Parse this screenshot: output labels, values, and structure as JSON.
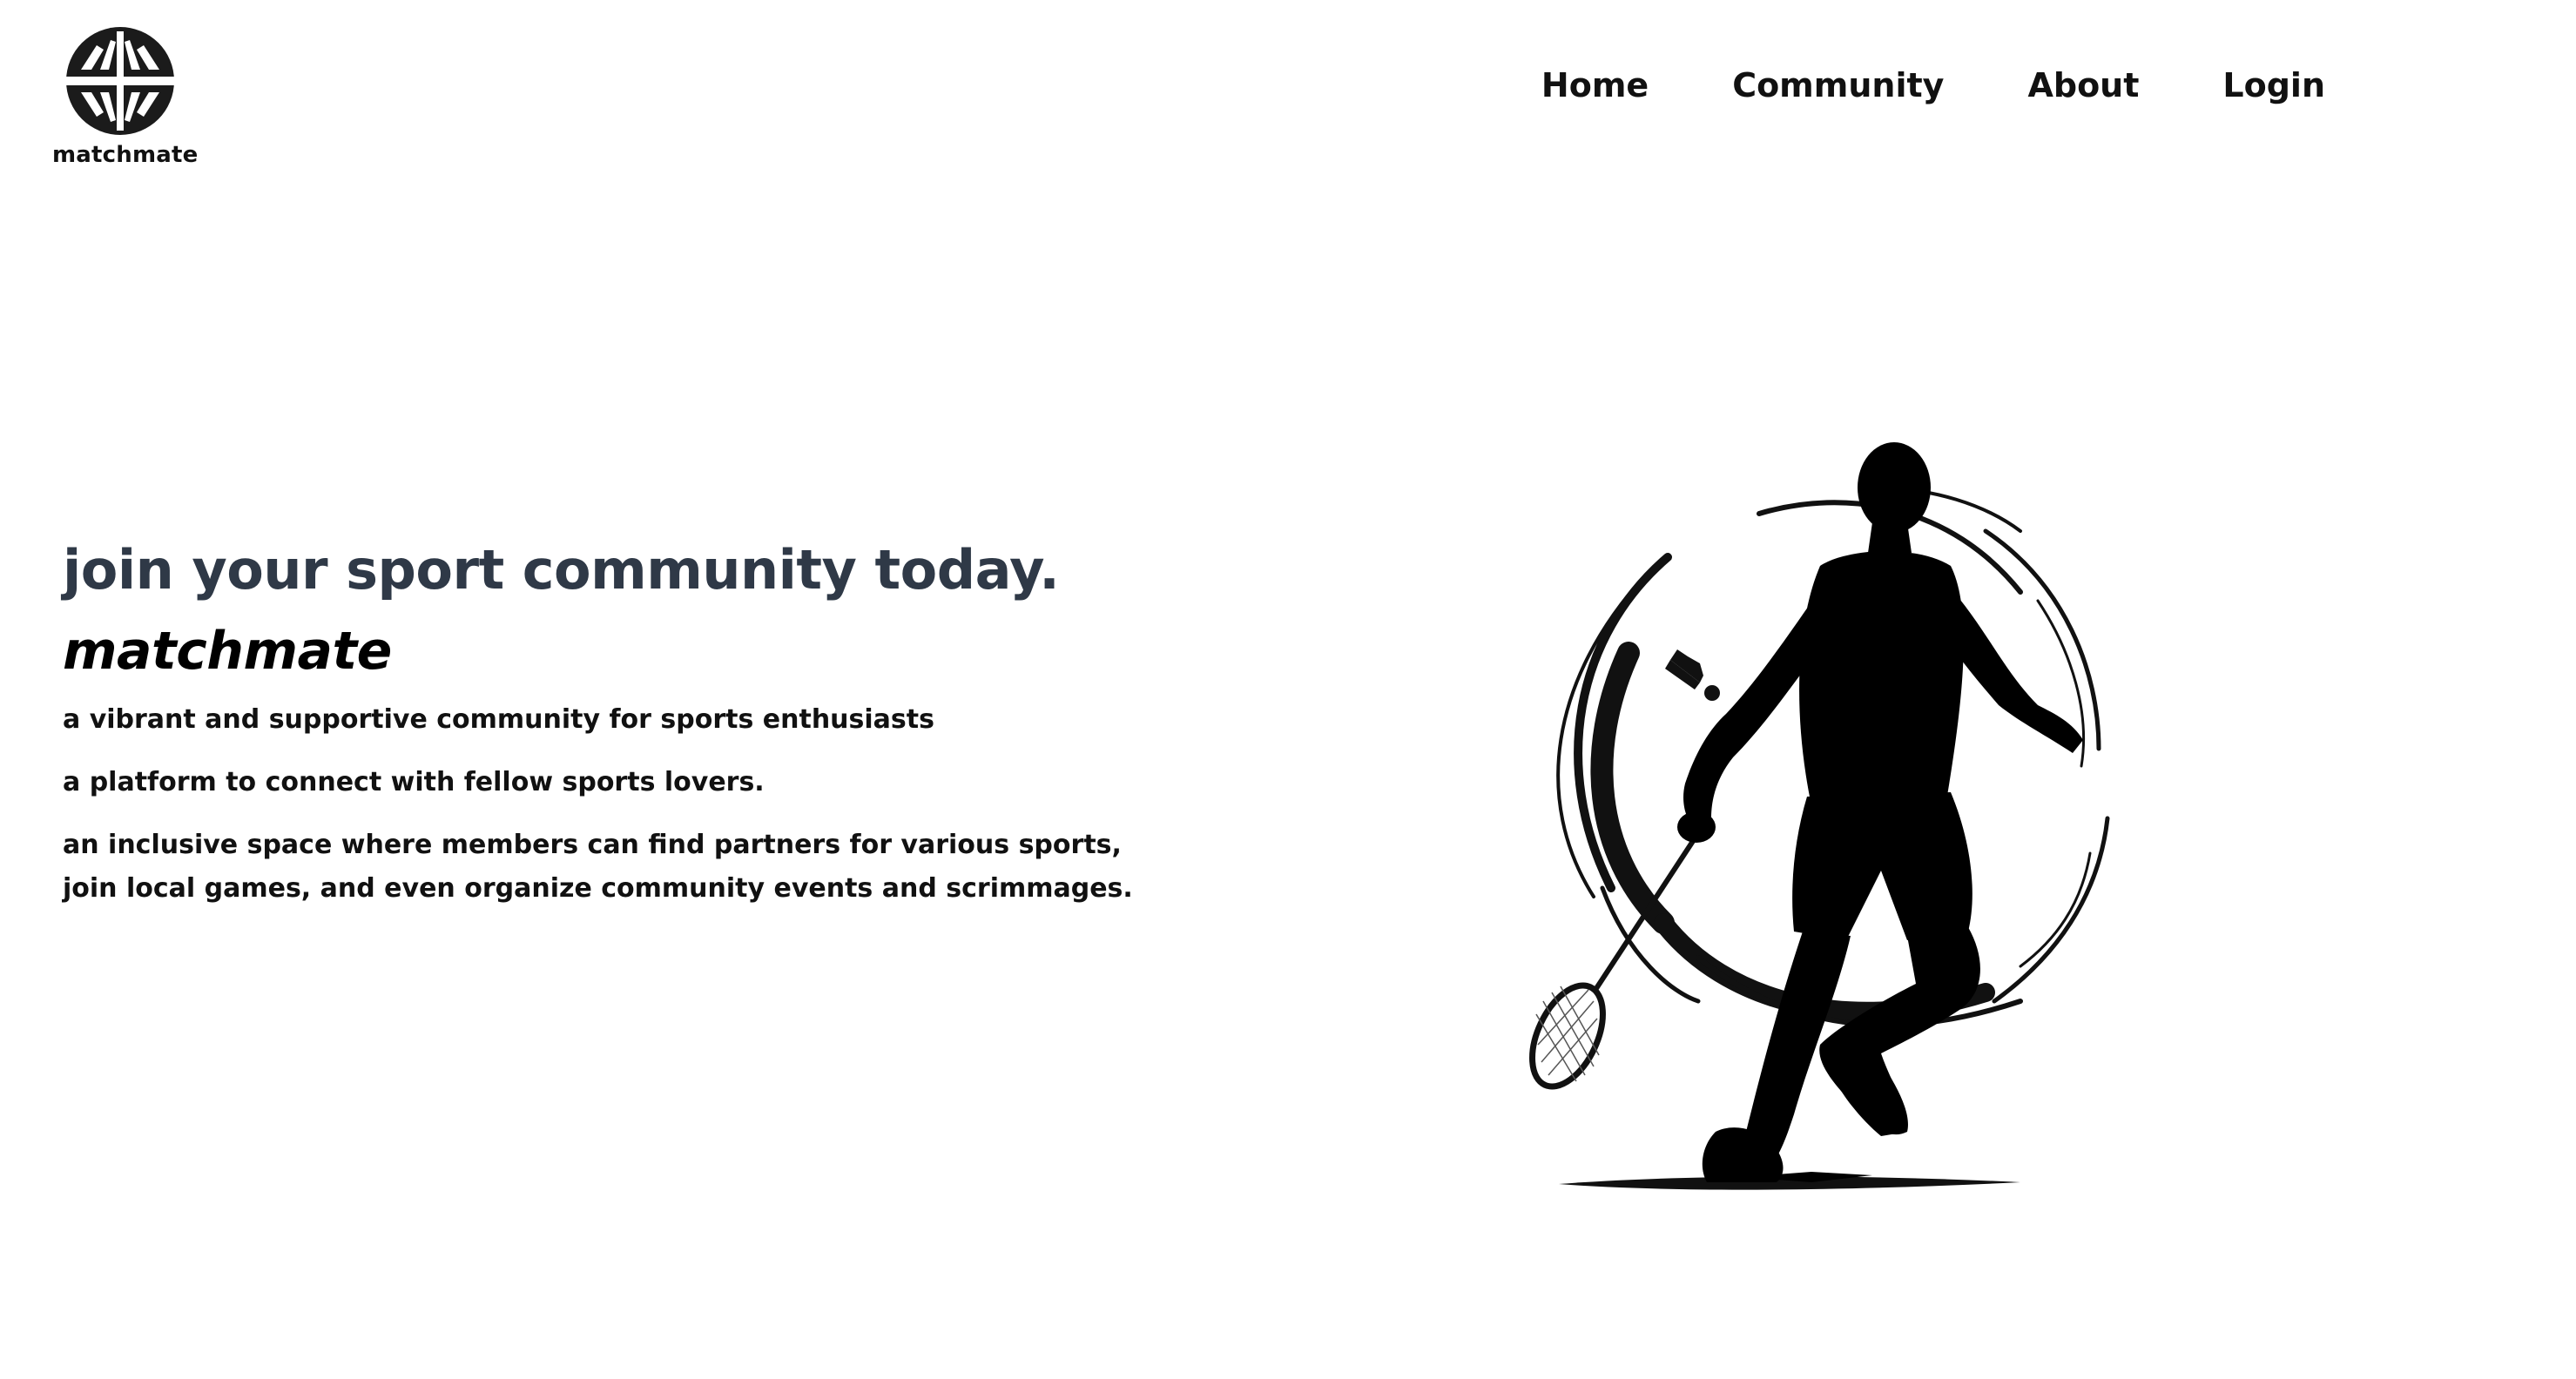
{
  "header": {
    "logo_text": "matchmate",
    "nav": [
      {
        "label": "Home"
      },
      {
        "label": "Community"
      },
      {
        "label": "About"
      },
      {
        "label": "Login"
      }
    ]
  },
  "hero": {
    "headline": "join your sport community today.",
    "brand": "matchmate",
    "paragraphs": [
      "a vibrant and supportive community for sports enthusiasts",
      "a platform to connect with fellow sports lovers.",
      "an inclusive space where members can find partners for various sports, join local games, and even organize community events and scrimmages."
    ]
  },
  "illustration": {
    "icon": "badminton-player-illustration"
  },
  "colors": {
    "headline": "#2f3947",
    "text": "#111111",
    "background": "#ffffff"
  }
}
